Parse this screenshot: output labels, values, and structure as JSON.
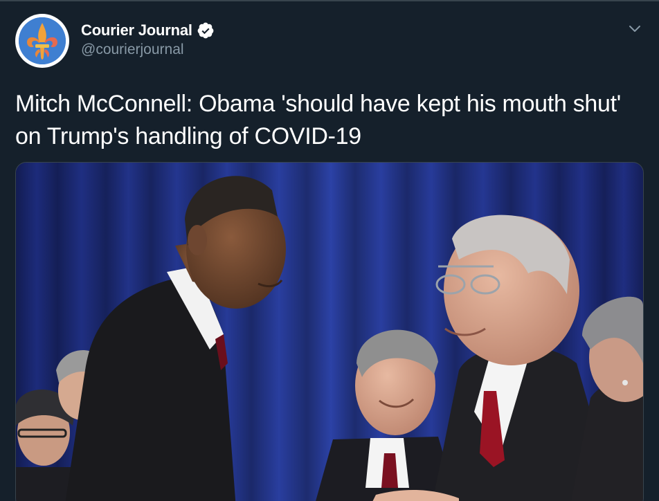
{
  "account": {
    "display_name": "Courier Journal",
    "handle": "@courierjournal",
    "verified": true,
    "avatar_icon": "fleur-de-lis-logo"
  },
  "tweet": {
    "text": "Mitch McConnell: Obama 'should have kept his mouth shut' on Trump's handling of COVID-19"
  },
  "menu": {
    "icon": "chevron-down-icon"
  },
  "colors": {
    "background": "#15202b",
    "secondary_text": "#8899a6",
    "verified_badge": "#ffffff",
    "border": "#38444d"
  }
}
